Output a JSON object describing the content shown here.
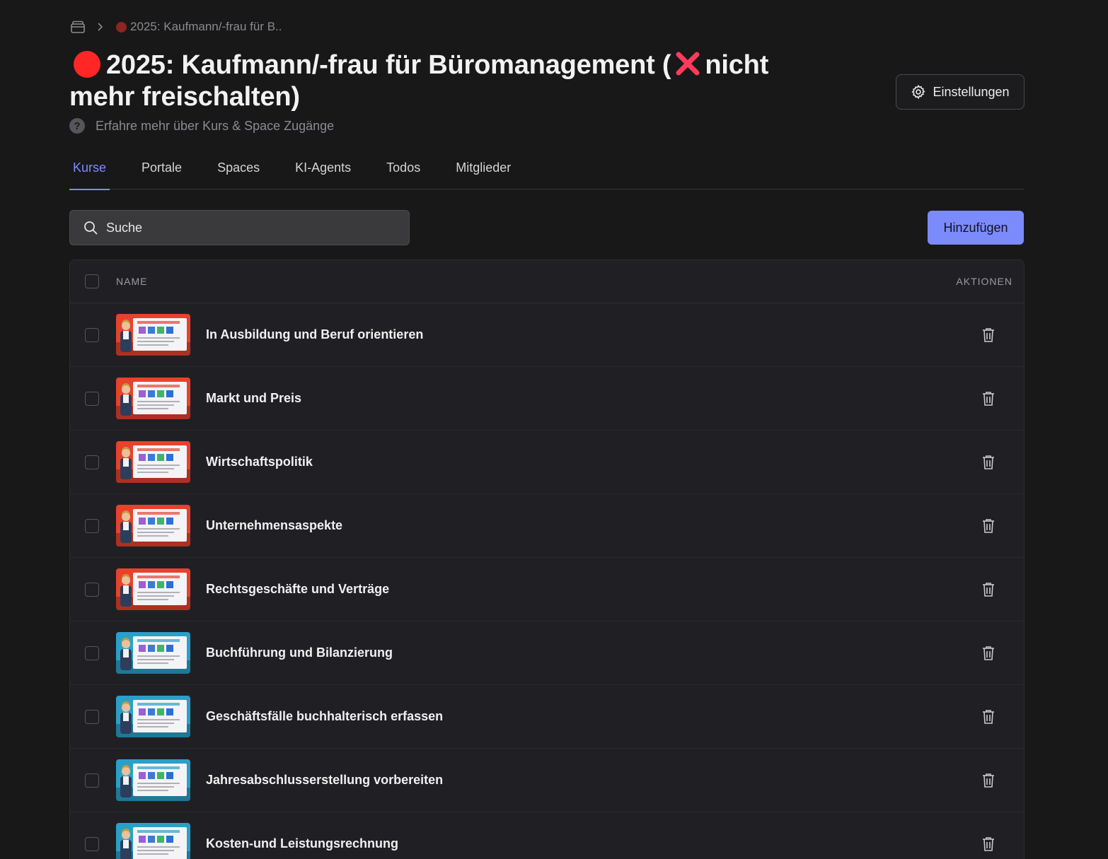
{
  "breadcrumb": {
    "home_icon": "folder-icon",
    "separator_icon": "chevron-right-icon",
    "current": "2025: Kaufmann/-frau für B.."
  },
  "header": {
    "title_part1": "2025: Kaufmann/-frau für Büromanagement (",
    "title_part2": "nicht mehr freischalten)",
    "status_dot_color": "#ff2626",
    "x_mark_color": "#ff3b5c",
    "help_text": "Erfahre mehr über Kurs & Space Zugänge",
    "settings_label": "Einstellungen"
  },
  "tabs": [
    {
      "label": "Kurse",
      "active": true
    },
    {
      "label": "Portale",
      "active": false
    },
    {
      "label": "Spaces",
      "active": false
    },
    {
      "label": "KI-Agents",
      "active": false
    },
    {
      "label": "Todos",
      "active": false
    },
    {
      "label": "Mitglieder",
      "active": false
    }
  ],
  "toolbar": {
    "search_placeholder": "Suche",
    "add_label": "Hinzufügen"
  },
  "table": {
    "col_name": "NAME",
    "col_actions": "AKTIONEN",
    "rows": [
      {
        "name": "In Ausbildung und Beruf orientieren",
        "accent": "#e8412c"
      },
      {
        "name": "Markt und Preis",
        "accent": "#e8412c"
      },
      {
        "name": "Wirtschaftspolitik",
        "accent": "#e8412c"
      },
      {
        "name": "Unternehmensaspekte",
        "accent": "#e8412c"
      },
      {
        "name": "Rechtsgeschäfte und Verträge",
        "accent": "#e8412c"
      },
      {
        "name": "Buchführung und Bilanzierung",
        "accent": "#2aa0c9"
      },
      {
        "name": "Geschäftsfälle buchhalterisch erfassen",
        "accent": "#2aa0c9"
      },
      {
        "name": "Jahresabschlusserstellung vorbereiten",
        "accent": "#2aa0c9"
      },
      {
        "name": "Kosten-und Leistungsrechnung",
        "accent": "#2aa0c9"
      }
    ]
  },
  "colors": {
    "accent": "#7d8cff",
    "background": "#181818",
    "table_bg": "#202024"
  }
}
